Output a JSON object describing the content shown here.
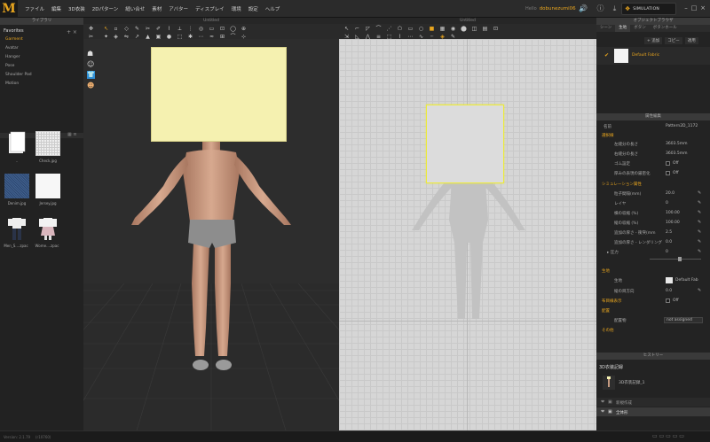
{
  "app": {
    "logo": "M"
  },
  "menu": [
    "ファイル",
    "編集",
    "3D衣装",
    "2Dパターン",
    "縫い合せ",
    "素材",
    "アバター",
    "ディスプレイ",
    "環境",
    "設定",
    "ヘルプ"
  ],
  "user": {
    "hello": "Hello",
    "name": "dobunezumi06"
  },
  "simulation": {
    "label": "SIMULATION"
  },
  "library": {
    "title": "ライブラリ",
    "favorites_title": "Favorites",
    "items": [
      "Garment",
      "Avatar",
      "Hanger",
      "Pose",
      "Shoulder Pad",
      "Motion"
    ],
    "files": [
      "..",
      "Check.jpg",
      "Denim.jpg",
      "Jersey.jpg",
      "Men_S....zpac",
      "Wome....zpac"
    ]
  },
  "viewport3d": {
    "title": "Untitled"
  },
  "viewport2d": {
    "title": "Untitled"
  },
  "object_browser": {
    "title": "オブジェクトブラウザ",
    "tabs": [
      "シーン",
      "生地",
      "ボタン",
      "ボタンホール"
    ],
    "add_label": "+ 追加",
    "copy_label": "コピー",
    "apply_label": "適用",
    "fabric_name": "Default Fabric"
  },
  "property_editor": {
    "title": "属性編集",
    "name_label": "名前",
    "name_value": "Pattern2D_1172",
    "sections": {
      "selection": "選択線",
      "simulation": "シミュレーション属性",
      "fabric": "生地",
      "grain": "布目方向",
      "arrangement": "配置",
      "other": "その他"
    },
    "rows": {
      "left_len_label": "左縫分の長さ",
      "left_len_value": "3603.5mm",
      "right_len_label": "右縫分の長さ",
      "right_len_value": "3603.5mm",
      "rubber_label": "ゴム設定",
      "rubber_value": "Off",
      "thickness_label": "厚みの表現の厳密化",
      "thickness_value": "Off",
      "particle_label": "粒子間隔(mm)",
      "particle_value": "20.0",
      "layer_label": "レイヤ",
      "layer_value": "0",
      "shrink_w_label": "横の収縮 (%)",
      "shrink_w_value": "100.00",
      "shrink_h_label": "縦の収縮 (%)",
      "shrink_h_value": "100.00",
      "add_thick_label": "追加の厚さ - 衝突(mm",
      "add_thick_value": "2.5",
      "add_thick2_label": "追加の厚さ - レンダリング",
      "add_thick2_value": "0.0",
      "pressure_label": "圧力",
      "pressure_value": "0",
      "fabric_label": "生地",
      "fabric_value": "Default Fab",
      "grain_dir_label": "縦の目方向",
      "grain_dir_value": "0.0",
      "grain_show_label": "布目線表示",
      "grain_show_value": "Off",
      "arrange_label": "配置物",
      "arrange_value": "not assigned"
    }
  },
  "history": {
    "title": "ヒストリー",
    "section": "3D衣装記録",
    "snapshot_label": "3D衣装記録_1",
    "entries": [
      "新規作成",
      "全体形"
    ]
  },
  "status": {
    "version": "Version: 2.1.79",
    "build": "(r10760)"
  }
}
